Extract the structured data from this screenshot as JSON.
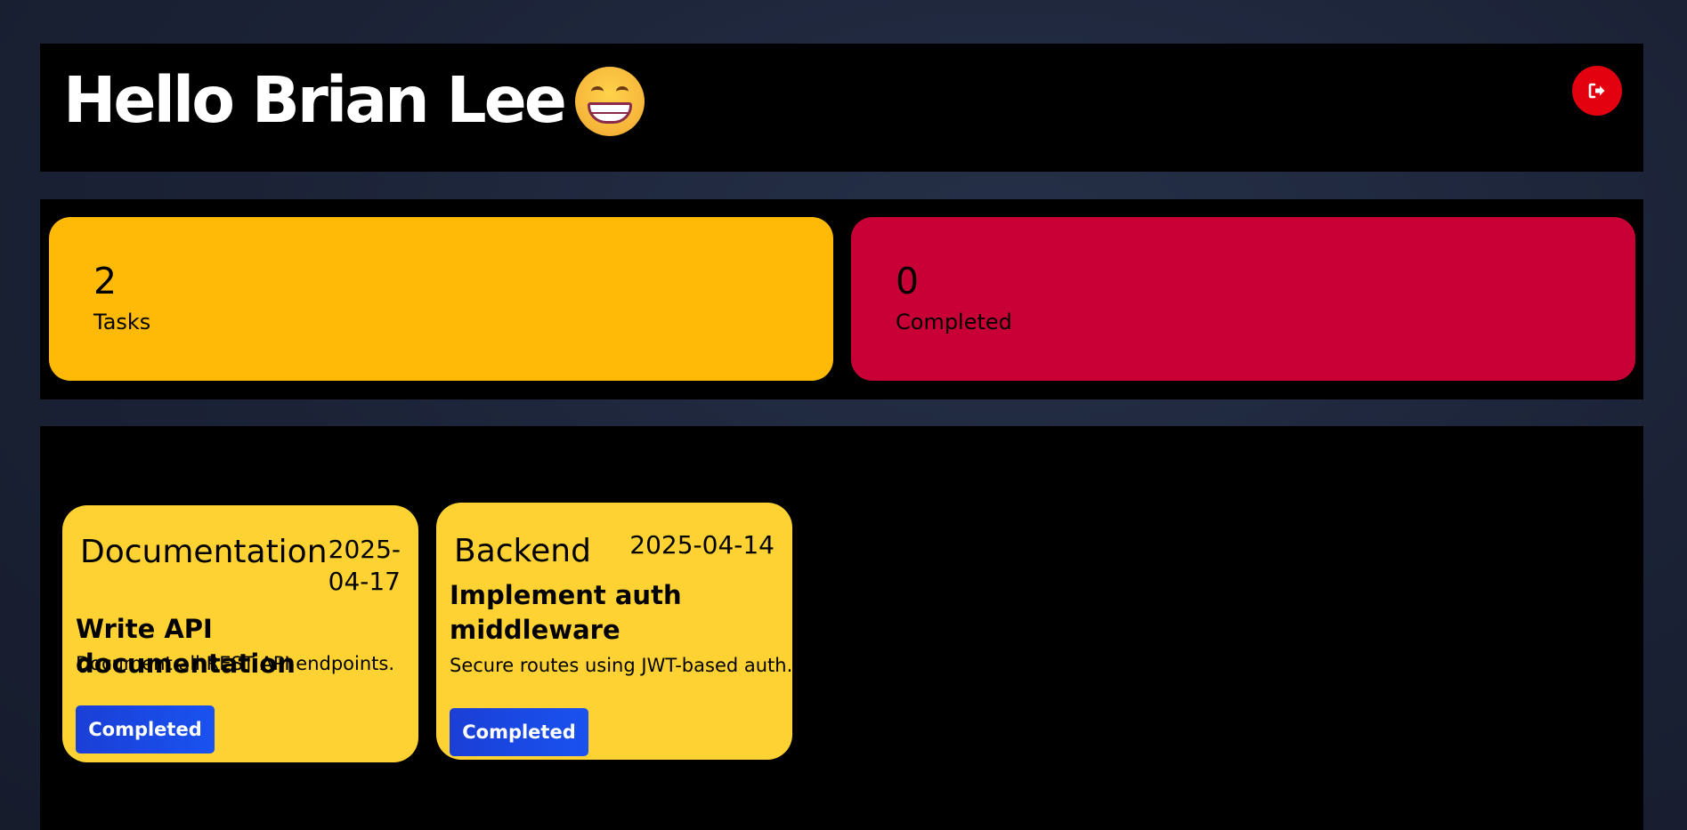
{
  "header": {
    "greeting": "Hello Brian Lee",
    "emoji_icon": "grinning-face-icon",
    "logout_icon": "sign-out-icon",
    "logout_color": "#e3000f"
  },
  "stats": [
    {
      "value": "2",
      "label": "Tasks",
      "color": "#ffba08"
    },
    {
      "value": "0",
      "label": "Completed",
      "color": "#c90036"
    }
  ],
  "tasks": [
    {
      "category": "Documentation",
      "date": "2025-04-17",
      "title": "Write API documentation",
      "description": "Document all REST API endpoints.",
      "status_label": "Completed"
    },
    {
      "category": "Backend",
      "date": "2025-04-14",
      "title": "Implement auth middleware",
      "description": "Secure routes using JWT-based auth.",
      "status_label": "Completed"
    }
  ],
  "colors": {
    "card": "#ffd233",
    "button": "#1a4ae6",
    "panel": "#000000"
  }
}
